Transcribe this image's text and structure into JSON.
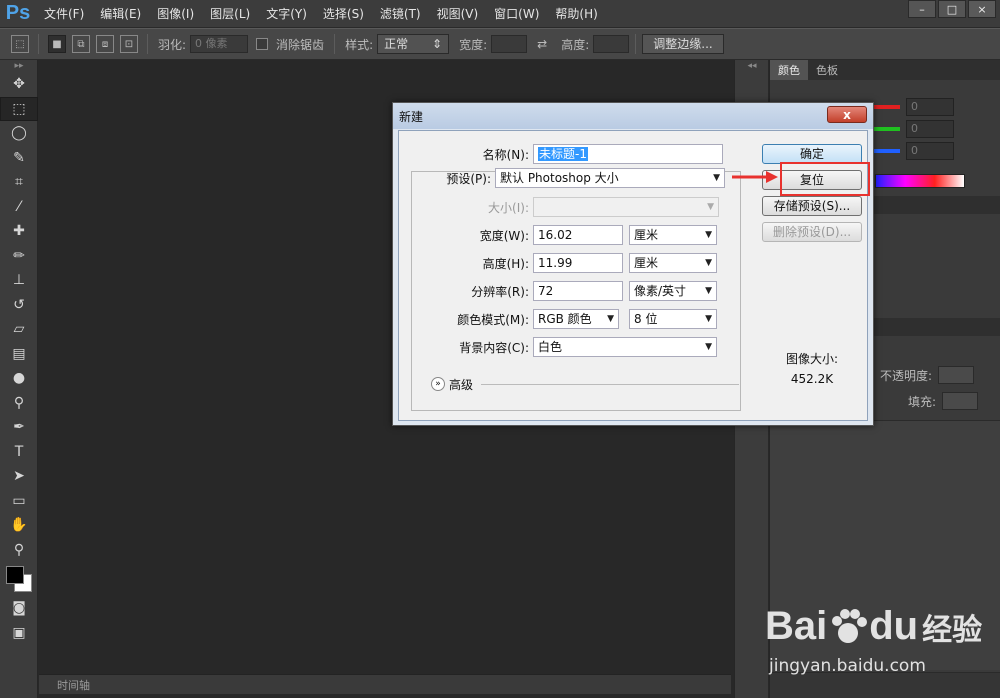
{
  "app": {
    "logo": "Ps",
    "menu": [
      "文件(F)",
      "编辑(E)",
      "图像(I)",
      "图层(L)",
      "文字(Y)",
      "选择(S)",
      "滤镜(T)",
      "视图(V)",
      "窗口(W)",
      "帮助(H)"
    ],
    "window_controls": [
      "–",
      "□",
      "×"
    ]
  },
  "options_bar": {
    "feather_label": "羽化:",
    "feather_placeholder": "0 像素",
    "antialias_label": "消除锯齿",
    "style_label": "样式:",
    "style_value": "正常",
    "width_label": "宽度:",
    "height_label": "高度:",
    "refine_button": "调整边缘..."
  },
  "timeline": {
    "label": "时间轴"
  },
  "panels": {
    "tabs": [
      "颜色",
      "色板"
    ],
    "rgb_values": [
      "0",
      "0",
      "0"
    ],
    "rgb_colors": [
      "#e02020",
      "#20c020",
      "#2060ff"
    ],
    "opacity_label": "不透明度:",
    "fill_label": "填充:"
  },
  "dialog": {
    "title": "新建",
    "close_label": "x",
    "name_label": "名称(N):",
    "name_value": "未标题-1",
    "preset_label": "预设(P):",
    "preset_value": "默认 Photoshop 大小",
    "size_label": "大小(I):",
    "width_label": "宽度(W):",
    "width_value": "16.02",
    "width_unit": "厘米",
    "height_label": "高度(H):",
    "height_value": "11.99",
    "height_unit": "厘米",
    "resolution_label": "分辨率(R):",
    "resolution_value": "72",
    "resolution_unit": "像素/英寸",
    "color_mode_label": "颜色模式(M):",
    "color_mode_value": "RGB 颜色",
    "bit_depth_value": "8 位",
    "background_label": "背景内容(C):",
    "background_value": "白色",
    "advanced_label": "高级",
    "ok_button": "确定",
    "reset_button": "复位",
    "save_preset_button": "存储预设(S)...",
    "delete_preset_button": "删除预设(D)...",
    "image_size_label": "图像大小:",
    "image_size_value": "452.2K"
  },
  "watermark": {
    "brand": "Bai",
    "brand2": "du",
    "product": "经验",
    "url": "jingyan.baidu.com"
  }
}
